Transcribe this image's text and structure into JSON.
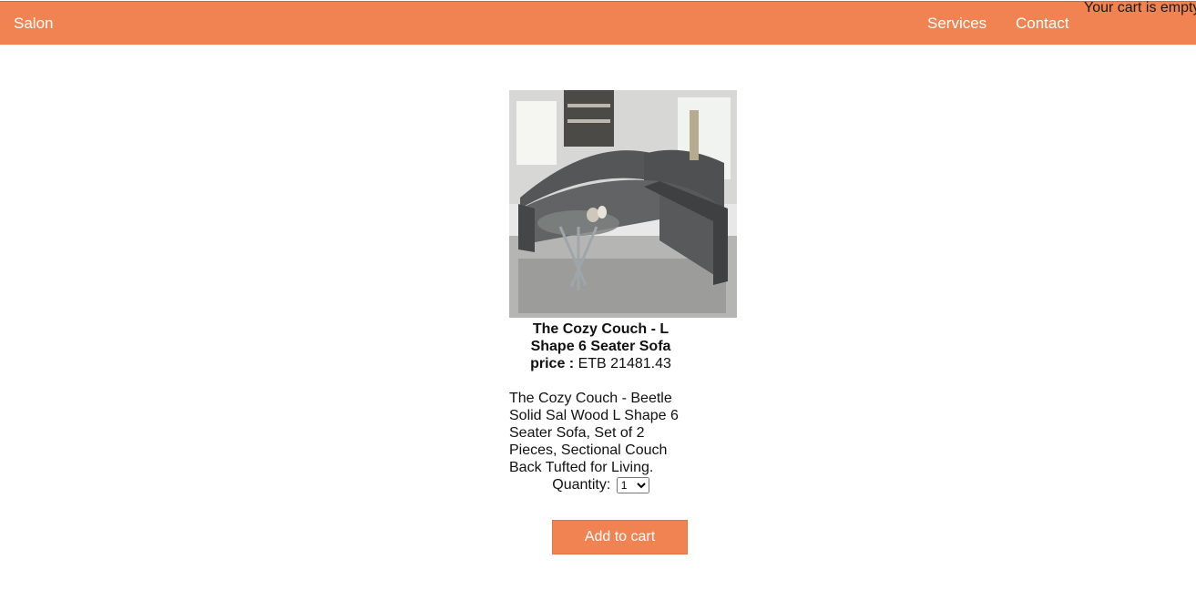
{
  "navbar": {
    "brand": "Salon",
    "links": [
      "Services",
      "Contact"
    ],
    "cart_status": "Your cart is empty",
    "color": "#f08351"
  },
  "product": {
    "title": "The Cozy Couch - L Shape 6 Seater Sofa",
    "price_label": "price :",
    "price_value": "ETB 21481.43",
    "description": "The Cozy Couch - Beetle Solid Sal Wood L Shape 6 Seater Sofa, Set of 2 Pieces, Sectional Couch Back Tufted for Living.",
    "quantity_label": "Quantity:",
    "quantity_selected": "1",
    "image_icon": "sectional-sofa-photo"
  },
  "actions": {
    "add_to_cart_label": "Add to cart"
  }
}
